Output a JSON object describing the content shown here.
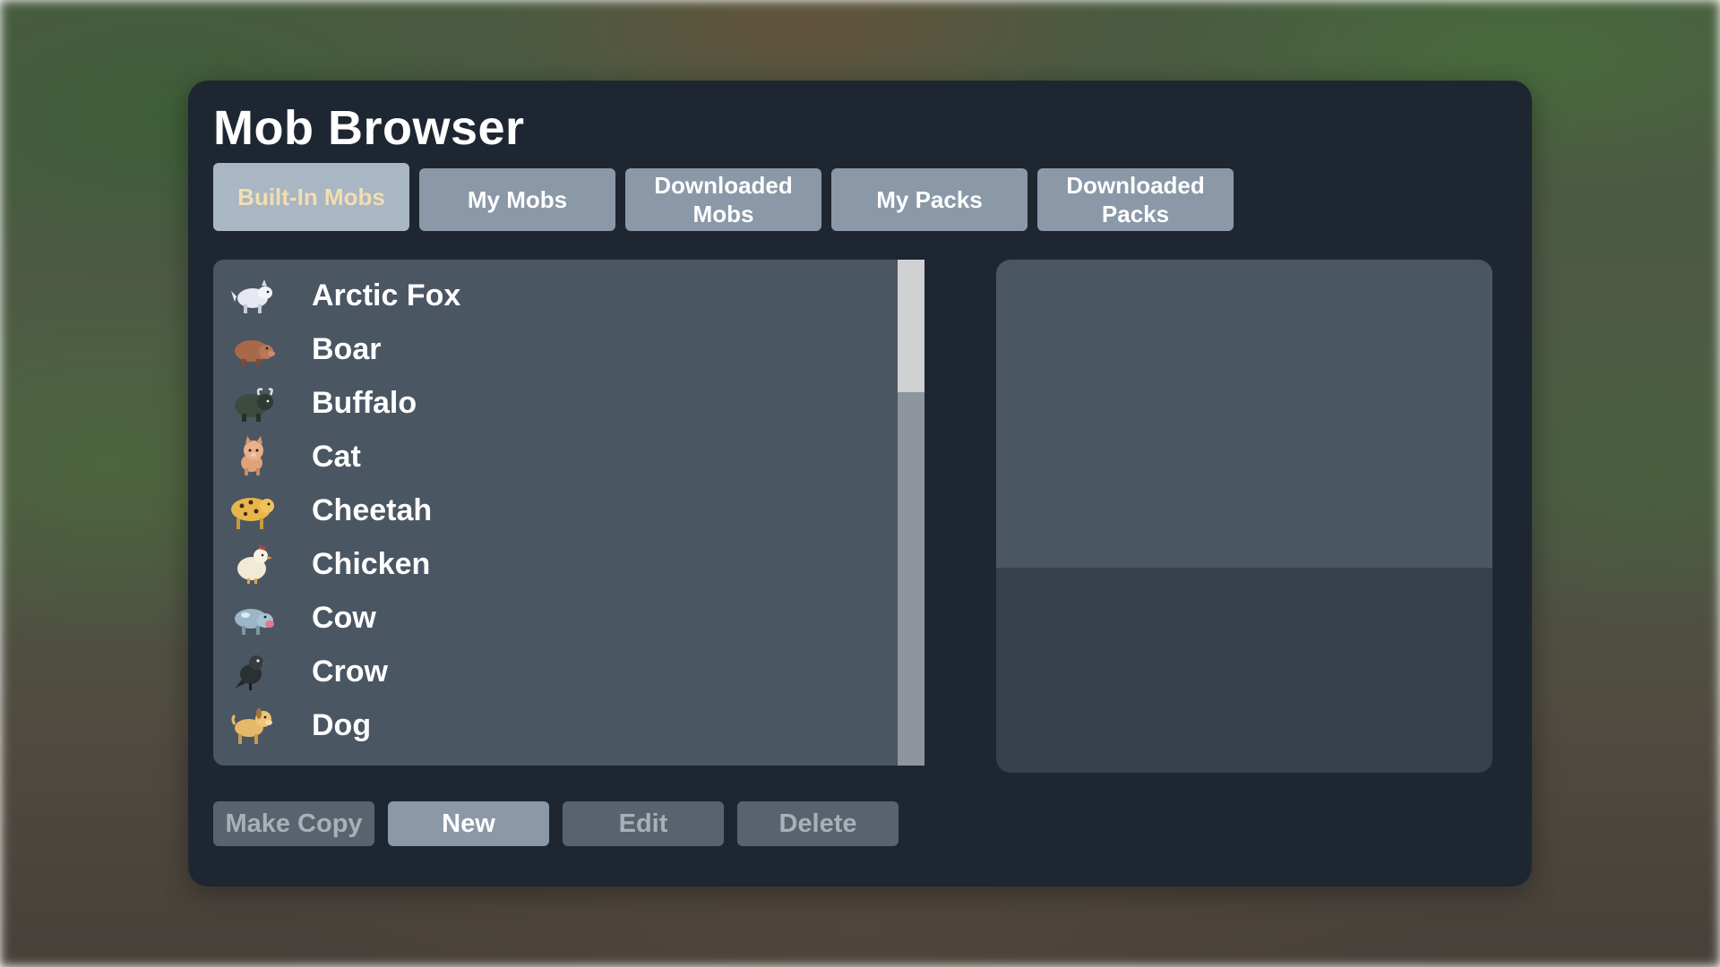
{
  "dialog": {
    "title": "Mob Browser"
  },
  "tabs": [
    {
      "label": "Built-In Mobs",
      "active": true
    },
    {
      "label": "My Mobs",
      "active": false
    },
    {
      "label": "Downloaded\nMobs",
      "active": false
    },
    {
      "label": "My Packs",
      "active": false
    },
    {
      "label": "Downloaded\nPacks",
      "active": false
    }
  ],
  "mob_list": {
    "items": [
      {
        "name": "Arctic Fox",
        "icon": "arctic-fox-icon"
      },
      {
        "name": "Boar",
        "icon": "boar-icon"
      },
      {
        "name": "Buffalo",
        "icon": "buffalo-icon"
      },
      {
        "name": "Cat",
        "icon": "cat-icon"
      },
      {
        "name": "Cheetah",
        "icon": "cheetah-icon"
      },
      {
        "name": "Chicken",
        "icon": "chicken-icon"
      },
      {
        "name": "Cow",
        "icon": "cow-icon"
      },
      {
        "name": "Crow",
        "icon": "crow-icon"
      },
      {
        "name": "Dog",
        "icon": "dog-icon"
      }
    ],
    "scroll_position": 0
  },
  "actions": {
    "make_copy_label": "Make Copy",
    "new_label": "New",
    "edit_label": "Edit",
    "delete_label": "Delete"
  },
  "colors": {
    "dialog_bg": "#1e2731",
    "panel_bg": "#4b5663",
    "tab_bg": "#8a98a8",
    "tab_active_bg": "#a9b6c4",
    "tab_active_text": "#f2deb0",
    "disabled_button_bg": "#59636e"
  }
}
